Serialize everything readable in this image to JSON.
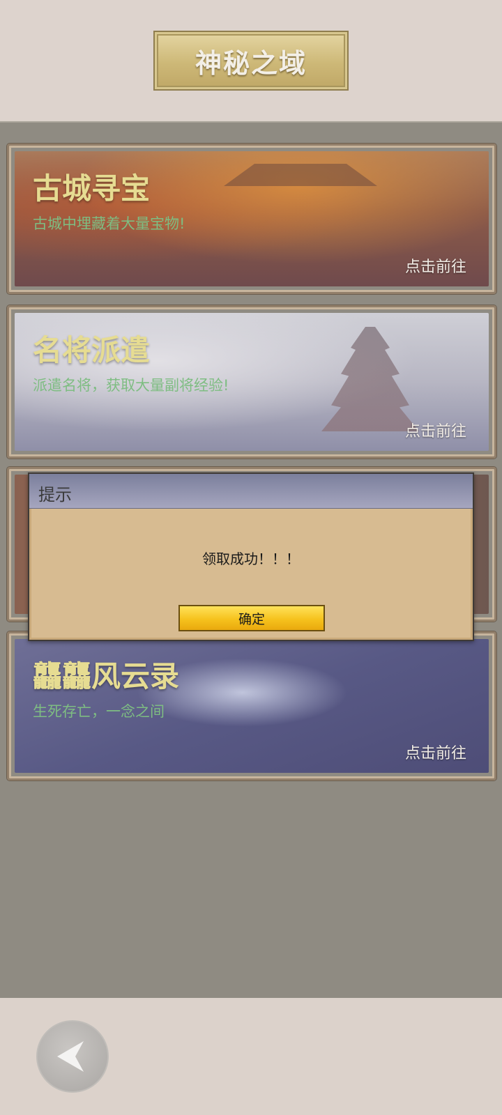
{
  "header": {
    "title": "神秘之域"
  },
  "cards": [
    {
      "title": "古城寻宝",
      "desc": "古城中埋藏着大量宝物!",
      "action": "点击前往"
    },
    {
      "title": "名将派遣",
      "desc": "派遣名将，获取大量副将经验!",
      "action": "点击前往"
    },
    {
      "title": "",
      "desc": "",
      "action": ""
    },
    {
      "title": "龘龘风云录",
      "desc": "生死存亡，一念之间",
      "action": "点击前往"
    }
  ],
  "dialog": {
    "title": "提示",
    "message": "领取成功！！！",
    "confirm_label": "确定"
  },
  "bottom": {
    "back_icon": "back-arrow-icon"
  }
}
